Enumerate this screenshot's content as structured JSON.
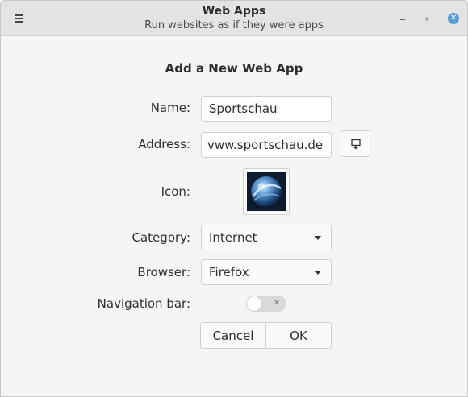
{
  "window": {
    "title": "Web Apps",
    "subtitle": "Run websites as if they were apps",
    "menu_icon": "hamburger-menu-icon",
    "controls": [
      "minimize-icon",
      "maximize-icon",
      "close-icon"
    ],
    "accent": "#5b9bd6"
  },
  "form": {
    "heading": "Add a New Web App",
    "name_label": "Name:",
    "name_value": "Sportschau",
    "address_label": "Address:",
    "address_value": "vww.sportschau.de",
    "favicon_button_icon": "favicon-download-icon",
    "icon_label": "Icon:",
    "icon_image": "globe-app-icon",
    "category_label": "Category:",
    "category_value": "Internet",
    "browser_label": "Browser:",
    "browser_value": "Firefox",
    "navbar_label": "Navigation bar:",
    "navbar_enabled": false,
    "cancel_label": "Cancel",
    "ok_label": "OK"
  }
}
